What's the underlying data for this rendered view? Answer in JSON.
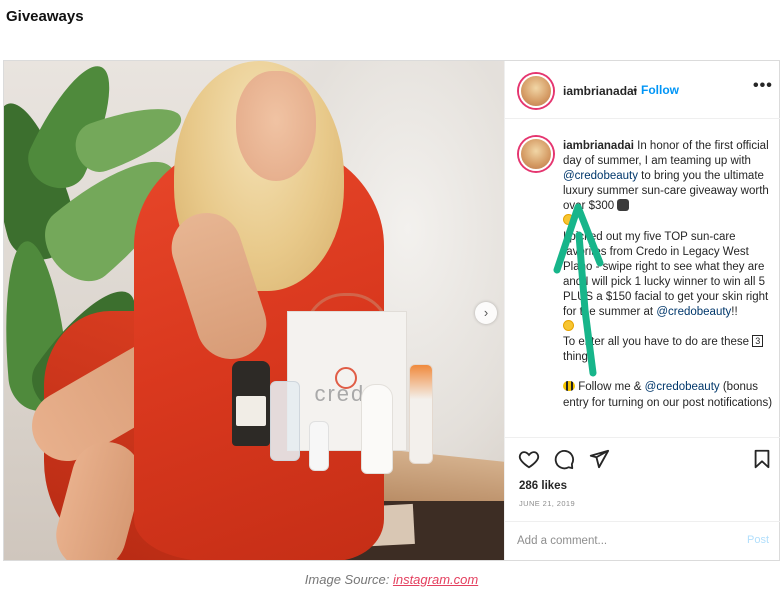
{
  "section": {
    "title": "Giveaways"
  },
  "post": {
    "username": "iambrianadai",
    "follow_separator": "•",
    "follow_label": "Follow",
    "more_label": "•••",
    "caption": {
      "username": "iambrianadai",
      "line1_a": " In honor of the first official day of summer, I am teaming up with ",
      "mention1": "@credobeauty",
      "line1_b": " to bring you the ultimate luxury summer sun-care giveaway worth over $300 ",
      "para2": "I picked out my five TOP sun-care favorites from Credo in Legacy West Plano - swipe right to see what they are and I will pick 1 lucky winner to win all 5 PLUS a $150 facial to get your skin right for the summer at ",
      "mention2": "@credobeauty",
      "para2_end": "!!",
      "para3_a": "To enter all you have to do are these ",
      "para3_box": "3",
      "para3_b": " things",
      "para4_a": " Follow me & ",
      "mention3": "@credobeauty",
      "para4_b": " (bonus entry for turning on our post notifications)"
    },
    "likes": "286 likes",
    "date": "JUNE 21, 2019",
    "comment_placeholder": "Add a comment...",
    "post_button": "Post",
    "bag_brand": "credo",
    "icons": [
      "heart-icon",
      "comment-icon",
      "share-icon",
      "bookmark-icon",
      "chevron-right-icon",
      "more-icon"
    ]
  },
  "footer": {
    "source_prefix": "Image Source: ",
    "source_link": "instagram.com"
  },
  "colors": {
    "follow": "#0095f6",
    "mention": "#00376b",
    "arrow": "#17b58a",
    "link": "#e4405f"
  }
}
